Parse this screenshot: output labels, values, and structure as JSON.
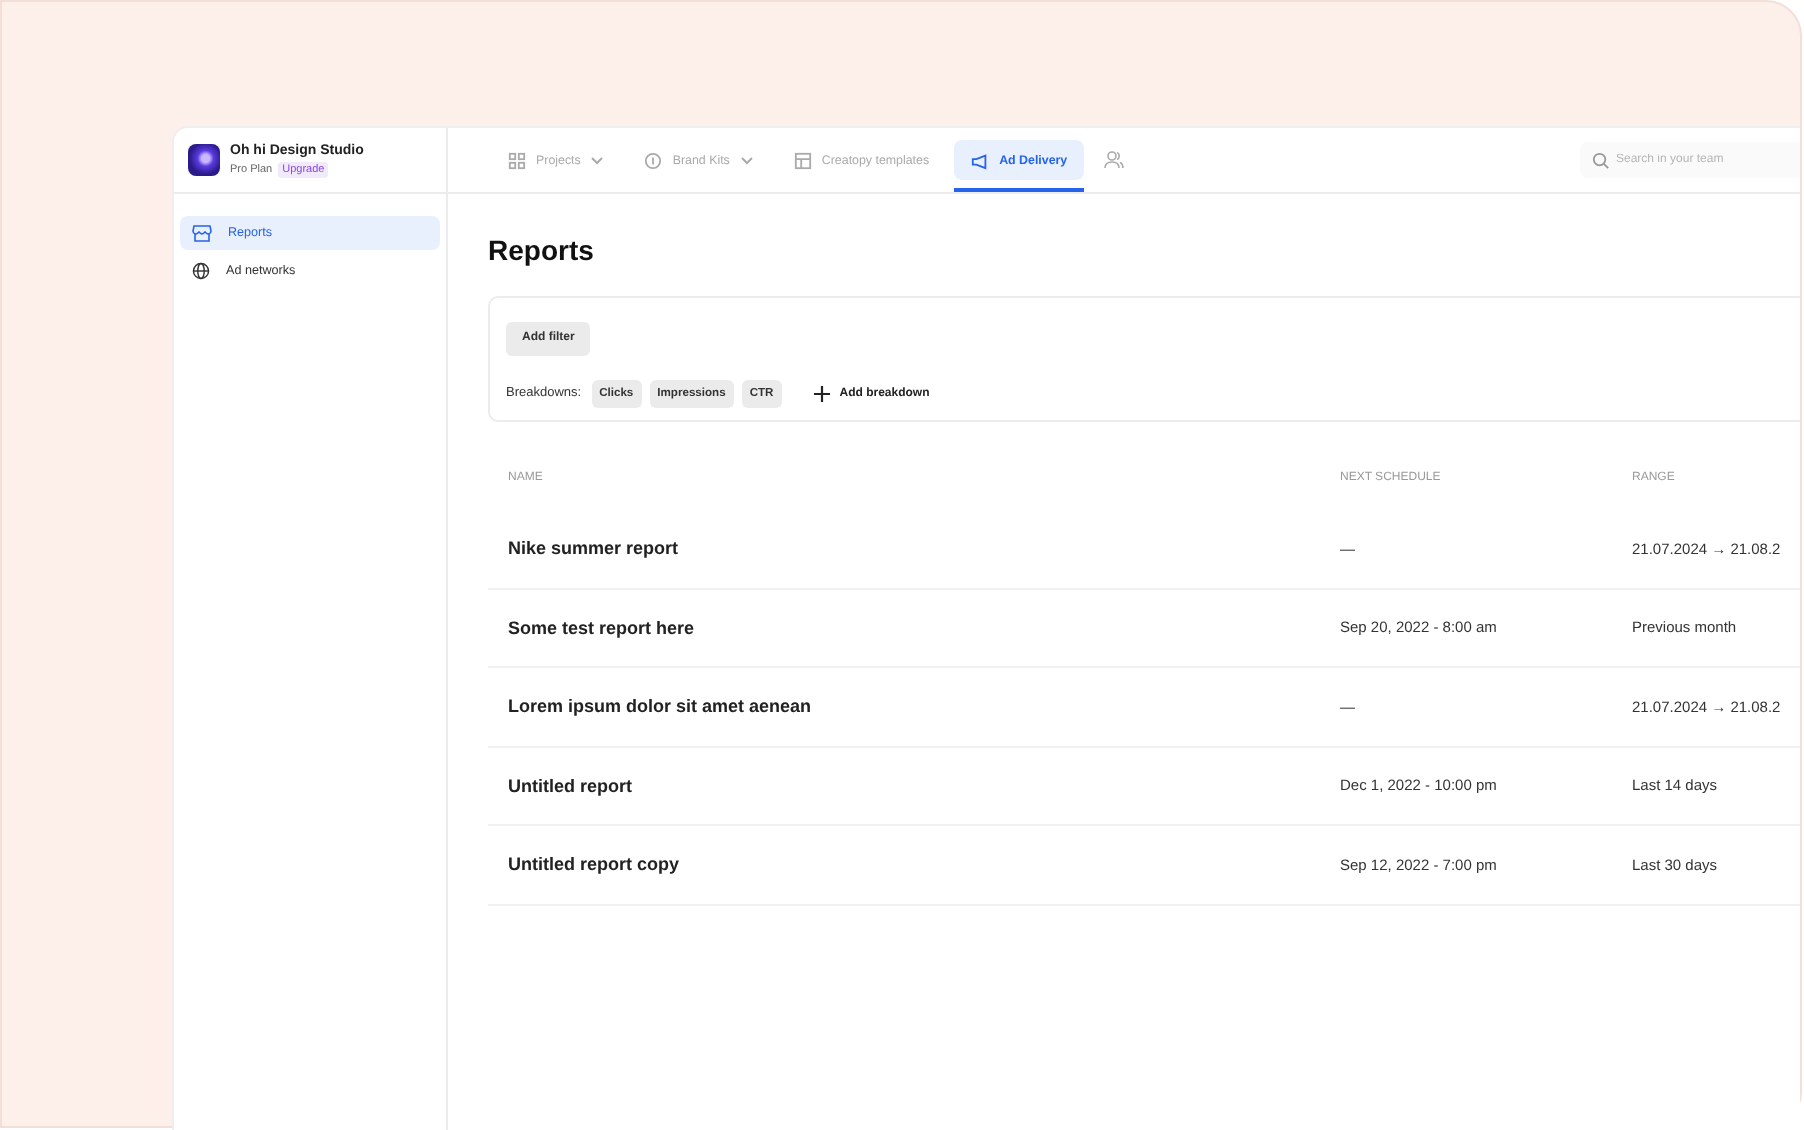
{
  "workspace": {
    "name": "Oh hi Design Studio",
    "plan": "Pro Plan",
    "upgrade": "Upgrade"
  },
  "nav_tabs": [
    {
      "label": "Projects",
      "dropdown": true,
      "selected": false
    },
    {
      "label": "Brand Kits",
      "dropdown": true,
      "selected": false
    },
    {
      "label": "Creatopy templates",
      "dropdown": false,
      "selected": false
    },
    {
      "label": "Ad Delivery",
      "dropdown": false,
      "selected": true
    }
  ],
  "search": {
    "placeholder": "Search in your team"
  },
  "sidebar": {
    "items": [
      {
        "label": "Reports",
        "selected": true
      },
      {
        "label": "Ad networks",
        "selected": false
      }
    ]
  },
  "page_title": "Reports",
  "filters": {
    "add_filter": "Add filter",
    "breakdowns_label": "Breakdowns:",
    "breakdowns": [
      "Clicks",
      "Impressions",
      "CTR"
    ],
    "add_breakdown": "Add breakdown"
  },
  "table": {
    "columns": [
      "NAME",
      "NEXT SCHEDULE",
      "RANGE"
    ],
    "rows": [
      [
        "Nike summer report",
        "—",
        "21.07.2024 → 21.08.2"
      ],
      [
        "Some test report here",
        "Sep 20, 2022 - 8:00 am",
        "Previous month"
      ],
      [
        "Lorem ipsum dolor sit amet aenean",
        "—",
        "21.07.2024 → 21.08.2"
      ],
      [
        "Untitled report",
        "Dec 1, 2022 - 10:00 pm",
        "Last 14 days"
      ],
      [
        "Untitled report copy",
        "Sep 12, 2022 - 7:00 pm",
        "Last 30 days"
      ]
    ]
  }
}
